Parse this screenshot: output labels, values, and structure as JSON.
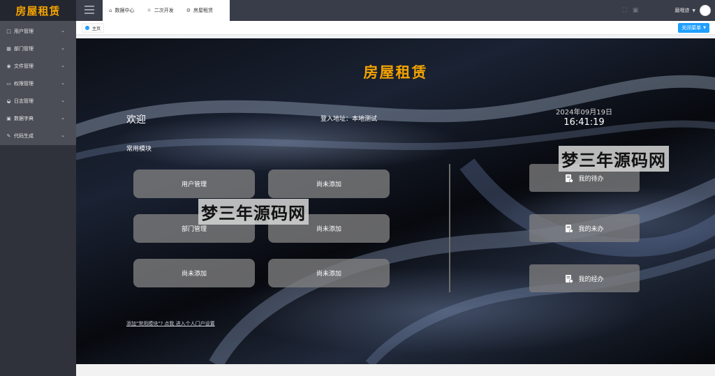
{
  "app": {
    "logo": "房屋租赁"
  },
  "sidebar": {
    "items": [
      {
        "label": "用户管理",
        "icon": "user-icon"
      },
      {
        "label": "部门管理",
        "icon": "department-icon"
      },
      {
        "label": "文件管理",
        "icon": "file-icon"
      },
      {
        "label": "权限管理",
        "icon": "monitor-icon"
      },
      {
        "label": "日志管理",
        "icon": "log-icon"
      },
      {
        "label": "数据字典",
        "icon": "dictionary-icon"
      },
      {
        "label": "代码生成",
        "icon": "code-icon"
      }
    ]
  },
  "header": {
    "tabs": [
      {
        "label": "数据中心",
        "icon": "home-icon"
      },
      {
        "label": "二次开发",
        "icon": "bulb-icon"
      },
      {
        "label": "房屋租赁",
        "icon": "gear-icon"
      }
    ],
    "user_name": "磨哦迹"
  },
  "tabbar": {
    "home_tab": "主页",
    "close_menu": "关闭菜单"
  },
  "main": {
    "title": "房屋租赁",
    "welcome": "欢迎",
    "login_address": "登入地址：本地测试",
    "date": "2024年09月19日",
    "time": "16:41:19",
    "modules_label": "常用模块",
    "modules": [
      "用户管理",
      "尚未添加",
      "部门管理",
      "尚未添加",
      "尚未添加",
      "尚未添加"
    ],
    "tasks": [
      "我的待办",
      "我的未办",
      "我的经办"
    ],
    "footer_link": "添加\"常用模块\"? 点我 进入个人门户设置"
  },
  "watermark": {
    "text": "梦三年源码网"
  },
  "colors": {
    "accent": "#f5a300",
    "primary": "#1e9fff",
    "sidebar_bg": "#2f323a",
    "header_bg": "#393d49"
  }
}
